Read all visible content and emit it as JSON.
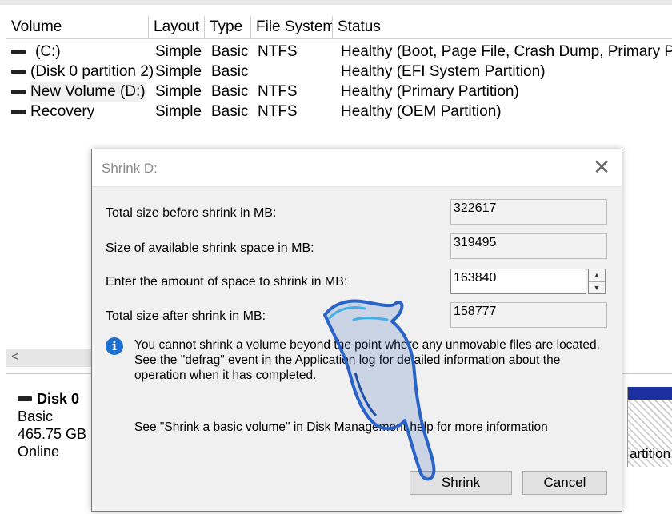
{
  "volume_table": {
    "columns": [
      "Volume",
      "Layout",
      "Type",
      "File System",
      "Status"
    ],
    "rows": [
      {
        "volume": "(C:)",
        "layout": "Simple",
        "type": "Basic",
        "fs": "NTFS",
        "status": "Healthy (Boot, Page File, Crash Dump, Primary Partiti"
      },
      {
        "volume": "(Disk 0 partition 2)",
        "layout": "Simple",
        "type": "Basic",
        "fs": "",
        "status": "Healthy (EFI System Partition)"
      },
      {
        "volume": "New Volume (D:)",
        "layout": "Simple",
        "type": "Basic",
        "fs": "NTFS",
        "status": "Healthy (Primary Partition)"
      },
      {
        "volume": "Recovery",
        "layout": "Simple",
        "type": "Basic",
        "fs": "NTFS",
        "status": "Healthy (OEM Partition)"
      }
    ]
  },
  "scroll": {
    "left_arrow": "<"
  },
  "disk": {
    "name": "Disk 0",
    "type": "Basic",
    "size": "465.75 GB",
    "state": "Online",
    "partition_fragment": "artition"
  },
  "dialog": {
    "title": "Shrink D:",
    "close_glyph": "✕",
    "fields": [
      {
        "label": "Total size before shrink in MB:",
        "value": "322617"
      },
      {
        "label": "Size of available shrink space in MB:",
        "value": "319495"
      },
      {
        "label": "Enter the amount of space to shrink in MB:",
        "value": "163840"
      },
      {
        "label": "Total size after shrink in MB:",
        "value": "158777"
      }
    ],
    "info_glyph": "i",
    "info_text": "You cannot shrink a volume beyond the point where any unmovable files are located. See the \"defrag\" event in the Application log for detailed information about the operation when it has completed.",
    "help_text": "See \"Shrink a basic volume\" in Disk Management help for more information",
    "buttons": {
      "shrink": "Shrink",
      "cancel": "Cancel"
    },
    "spinner": {
      "up": "▲",
      "down": "▼"
    }
  }
}
